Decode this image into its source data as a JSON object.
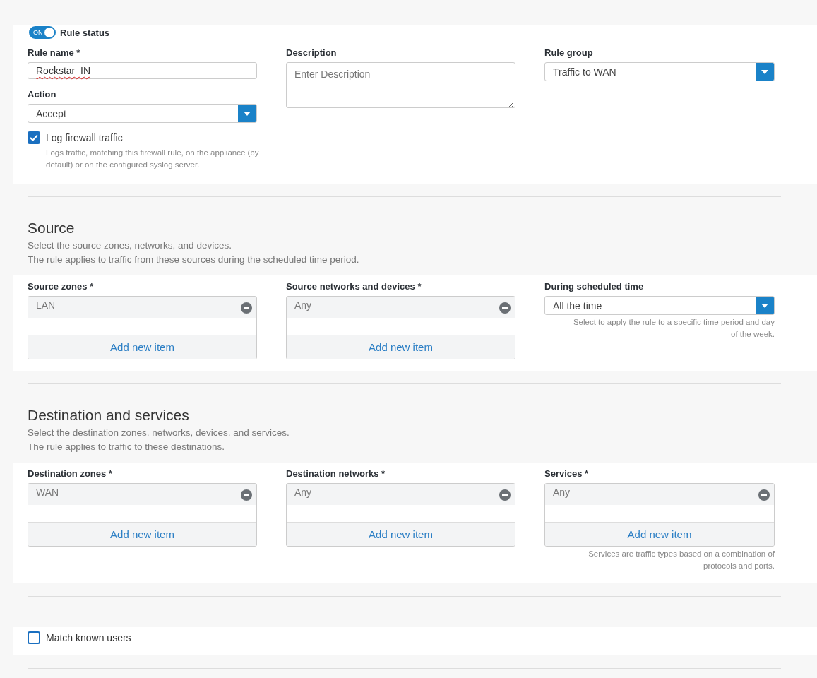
{
  "rule_status": {
    "label": "Rule status",
    "toggle_text": "ON",
    "on": true
  },
  "general": {
    "rule_name": {
      "label": "Rule name *",
      "value": "Rockstar_IN"
    },
    "action": {
      "label": "Action",
      "value": "Accept"
    },
    "log_traffic": {
      "label": "Log firewall traffic",
      "checked": true,
      "help": "Logs traffic, matching this firewall rule, on the appliance (by default) or on the configured syslog server."
    },
    "description": {
      "label": "Description",
      "placeholder": "Enter Description"
    },
    "rule_group": {
      "label": "Rule group",
      "value": "Traffic to WAN"
    }
  },
  "sections": [
    {
      "title": "Source",
      "subtitle": [
        "Select the source zones, networks, and devices.",
        "The rule applies to traffic from these sources during the scheduled time period."
      ],
      "fields": [
        {
          "kind": "list",
          "label": "Source zones *",
          "items": [
            "LAN"
          ],
          "add_label": "Add new item"
        },
        {
          "kind": "list",
          "label": "Source networks and devices *",
          "items": [
            "Any"
          ],
          "add_label": "Add new item"
        },
        {
          "kind": "select",
          "label": "During scheduled time",
          "value": "All the time",
          "help": "Select to apply the rule to a specific time period and day of the week."
        }
      ]
    },
    {
      "title": "Destination and services",
      "subtitle": [
        "Select the destination zones, networks, devices, and services.",
        "The rule applies to traffic to these destinations."
      ],
      "fields": [
        {
          "kind": "list",
          "label": "Destination zones *",
          "items": [
            "WAN"
          ],
          "add_label": "Add new item"
        },
        {
          "kind": "list",
          "label": "Destination networks *",
          "items": [
            "Any"
          ],
          "add_label": "Add new item"
        },
        {
          "kind": "list",
          "label": "Services *",
          "items": [
            "Any"
          ],
          "add_label": "Add new item",
          "help": "Services are traffic types based on a combination of protocols and ports."
        }
      ]
    }
  ],
  "match_known_users": {
    "label": "Match known users",
    "checked": false
  }
}
